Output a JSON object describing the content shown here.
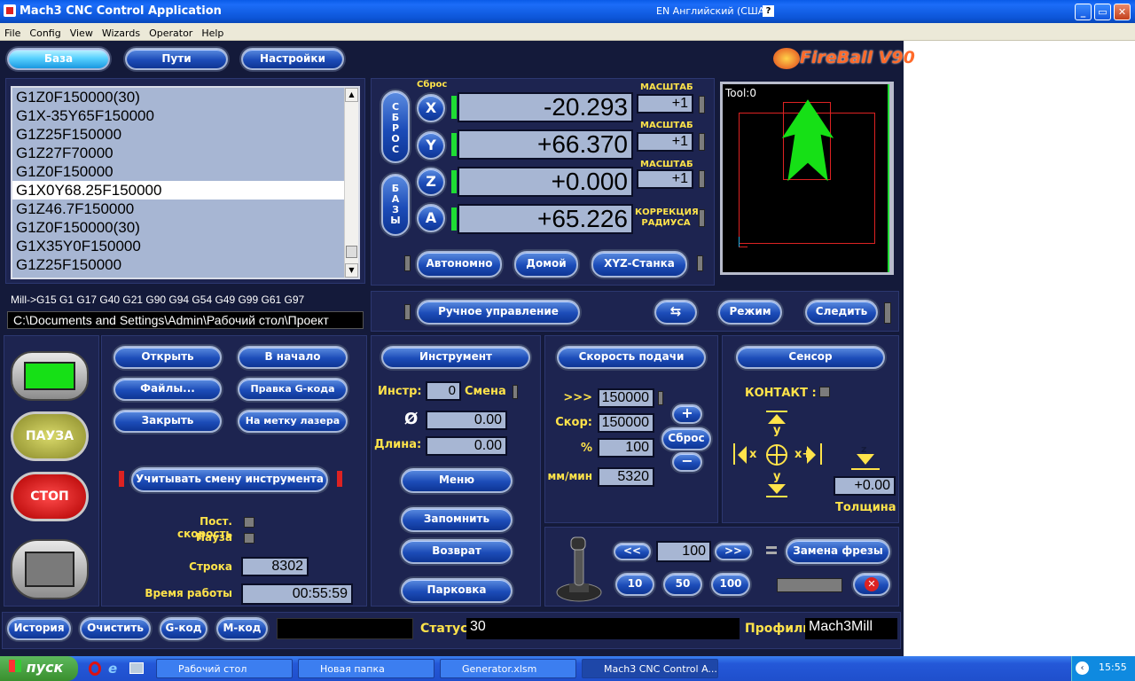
{
  "window": {
    "title": "Mach3 CNC Control Application",
    "lang_indicator": "EN Английский (США)",
    "help_btn": "?"
  },
  "menu": [
    "File",
    "Config",
    "View",
    "Wizards",
    "Operator",
    "Help"
  ],
  "tabs": {
    "base": "База",
    "paths": "Пути",
    "settings": "Настройки"
  },
  "logo": "FireBall V90",
  "gcode_lines": [
    "G1Z0F150000(30)",
    "G1X-35Y65F150000",
    "G1Z25F150000",
    "G1Z27F70000",
    "G1Z0F150000",
    "G1X0Y68.25F150000",
    "G1Z46.7F150000",
    "G1Z0F150000(30)",
    "G1X35Y0F150000",
    "G1Z25F150000"
  ],
  "gcode_selected_index": 5,
  "modal_line": "Mill->G15  G1 G17 G40 G21 G90 G94 G54 G49 G99 G61 G97",
  "file_path": "C:\\Documents and Settings\\Admin\\Рабочий стол\\Проект",
  "dro": {
    "reset_small": "Сброс",
    "reset_vertical": "СБРОС",
    "bases_vertical": "БАЗЫ",
    "axes": [
      {
        "name": "X",
        "value": "-20.293",
        "scale_label": "МАСШТАБ",
        "scale": "+1"
      },
      {
        "name": "Y",
        "value": "+66.370",
        "scale_label": "МАСШТАБ",
        "scale": "+1"
      },
      {
        "name": "Z",
        "value": "+0.000",
        "scale_label": "МАСШТАБ",
        "scale": "+1"
      },
      {
        "name": "A",
        "value": "+65.226",
        "scale_label": "КОРРЕКЦИЯ РАДИУСА",
        "scale": ""
      }
    ],
    "offline_btn": "Автономно",
    "home_btn": "Домой",
    "machine_btn": "XYZ-Станка"
  },
  "toolpath": {
    "tool_label": "Tool:0"
  },
  "jog_row": {
    "manual_btn": "Ручное управление",
    "mode_btn": "Режим",
    "follow_btn": "Следить"
  },
  "file_ctrl": {
    "open": "Открыть",
    "rewind": "В начало",
    "files": "Файлы...",
    "edit_gcode": "Правка G-кода",
    "close": "Закрыть",
    "laser_mark": "На метку лазера",
    "tool_change": "Учитывать смену инструмента",
    "const_speed": "Пост. скорость",
    "pause_lbl": "Пауза",
    "line_lbl": "Строка",
    "line_value": "8302",
    "runtime_lbl": "Время работы",
    "runtime_value": "00:55:59"
  },
  "cycle": {
    "pause": "ПАУЗА",
    "stop": "СТОП"
  },
  "tool": {
    "header": "Инструмент",
    "tool_lbl": "Инстр:",
    "tool_value": "0",
    "change_lbl": "Смена",
    "diam_symbol": "Ø",
    "diam_value": "0.00",
    "length_lbl": "Длина:",
    "length_value": "0.00",
    "menu": "Меню",
    "remember": "Запомнить",
    "return": "Возврат",
    "park": "Парковка"
  },
  "feed": {
    "header": "Скорость подачи",
    "arrows": ">>>",
    "override_value": "150000",
    "speed_lbl": "Скор:",
    "speed_value": "150000",
    "pct_lbl": "%",
    "pct_value": "100",
    "mmmin_lbl": "мм/мин",
    "mmmin_value": "5320",
    "plus": "+",
    "reset": "Сброс",
    "minus": "−"
  },
  "sensor": {
    "header": "Сенсор",
    "contact_lbl": "КОНТАКТ :",
    "y_plus": "y",
    "y_minus": "y",
    "x_minus": "x",
    "x_plus": "x+",
    "z_lbl": "z",
    "thickness_value": "+0.00",
    "thickness_lbl": "Толщина"
  },
  "jog": {
    "left": "<<",
    "value": "100",
    "right": ">>",
    "replace_cutter": "Замена фрезы",
    "s10": "10",
    "s50": "50",
    "s100": "100"
  },
  "bottom": {
    "history": "История",
    "clear": "Очистить",
    "gcode": "G-код",
    "mcode": "M-код",
    "status_lbl": "Статус",
    "status_value": "30",
    "profile_lbl": "Профиль",
    "profile_value": "Mach3Mill"
  },
  "taskbar": {
    "start": "пуск",
    "items": [
      "Рабочий стол",
      "Новая папка",
      "Generator.xlsm",
      "Mach3 CNC Control A..."
    ],
    "clock": "15:55"
  }
}
